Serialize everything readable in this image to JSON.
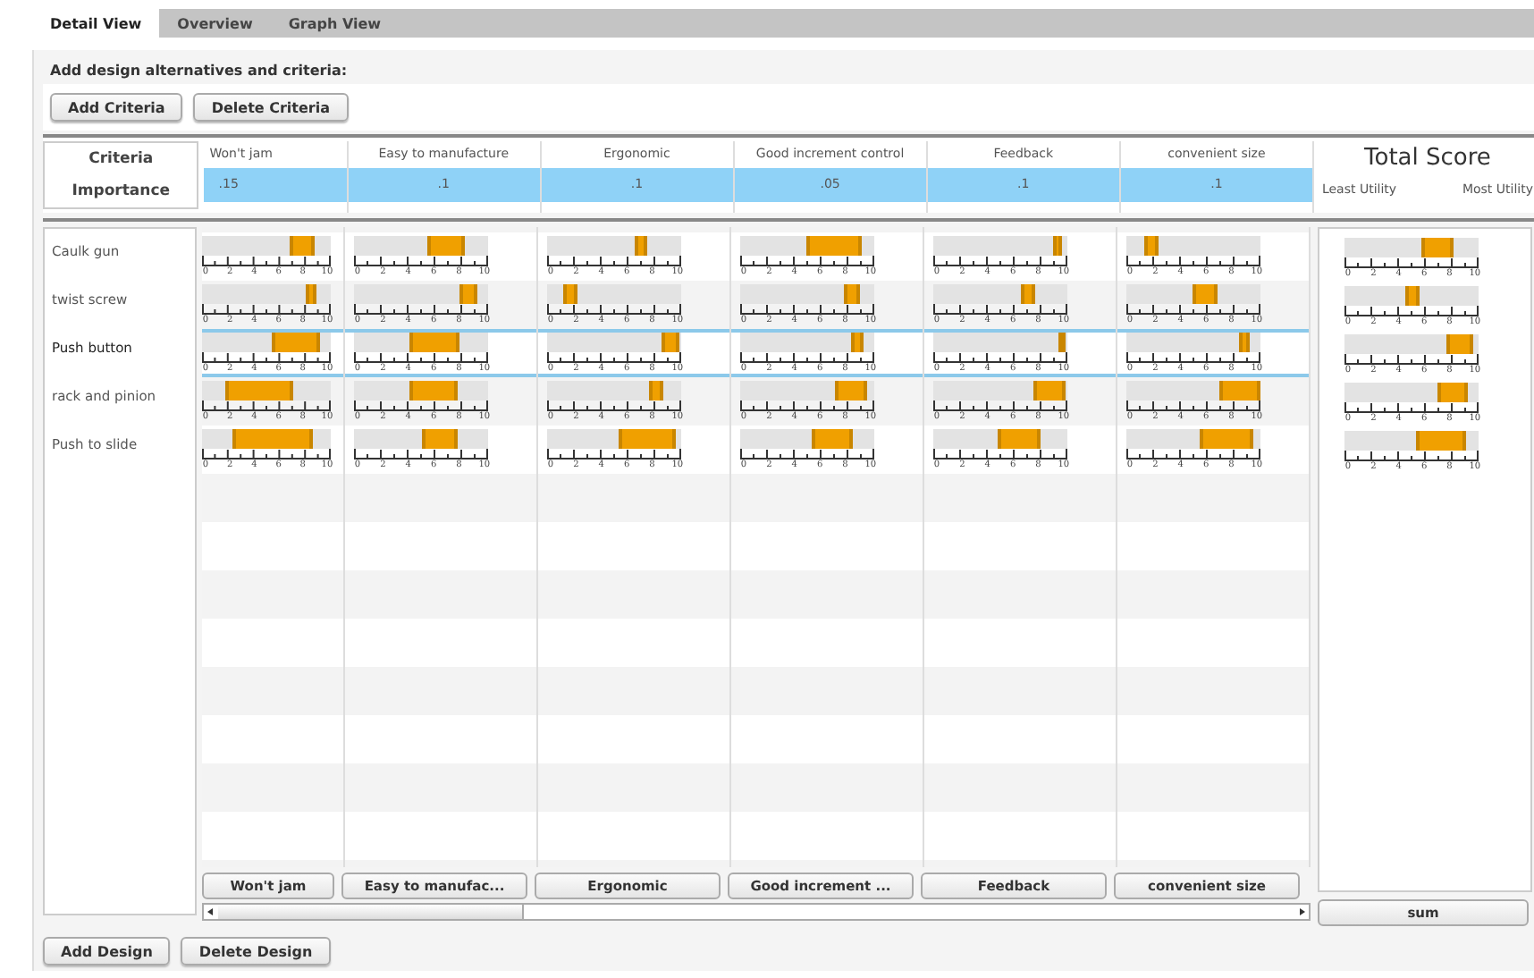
{
  "tabs": [
    {
      "label": "Detail View",
      "selected": true
    },
    {
      "label": "Overview",
      "selected": false
    },
    {
      "label": "Graph View",
      "selected": false
    }
  ],
  "instructions": "Add design alternatives and criteria:",
  "criteria_buttons": [
    "Add Criteria",
    "Delete Criteria"
  ],
  "criteria_header": {
    "criteria_label": "Criteria",
    "importance_label": "Importance"
  },
  "criteria": [
    {
      "name": "Won't jam",
      "importance": ".15"
    },
    {
      "name": "Easy to manufacture",
      "importance": ".1"
    },
    {
      "name": "Ergonomic",
      "importance": ".1"
    },
    {
      "name": "Good increment control",
      "importance": ".05"
    },
    {
      "name": "Feedback",
      "importance": ".1"
    },
    {
      "name": "convenient size",
      "importance": ".1"
    }
  ],
  "total_score": {
    "title": "Total Score",
    "least_label": "Least Utility",
    "most_label": "Most Utility",
    "button": "sum"
  },
  "designs": [
    {
      "name": "Caulk gun",
      "selected": false,
      "ratings": [
        {
          "low": {
            "level": 0.7
          },
          "high": {
            "level": 0.86
          },
          "scale": [
            "0",
            "2",
            "4",
            "6",
            "8",
            "10"
          ]
        },
        {
          "low": {
            "level": 0.56
          },
          "high": {
            "level": 0.81
          },
          "scale": [
            "0",
            "2",
            "4",
            "6",
            "8",
            "10"
          ]
        },
        {
          "low": {
            "level": 0.66
          },
          "high": {
            "level": 0.73
          },
          "scale": [
            "0",
            "2",
            "4",
            "6",
            "8",
            "10"
          ]
        },
        {
          "low": {
            "level": 0.5
          },
          "high": {
            "level": 0.89
          },
          "scale": [
            "0",
            "2",
            "4",
            "6",
            "8",
            "10"
          ]
        },
        {
          "low": {
            "level": 0.91
          },
          "high": {
            "level": 0.95
          },
          "scale": [
            "0",
            "2",
            "4",
            "6",
            "8",
            "10"
          ]
        },
        {
          "low": {
            "level": 0.15
          },
          "high": {
            "level": 0.22
          },
          "scale": [
            "0",
            "2",
            "4",
            "6",
            "8",
            "10"
          ]
        }
      ],
      "total": {
        "low": {
          "level": 0.59
        },
        "high": {
          "level": 0.8
        },
        "scale": [
          "0",
          "2",
          "4",
          "6",
          "8",
          "10"
        ]
      }
    },
    {
      "name": "twist screw",
      "selected": false,
      "ratings": [
        {
          "low": {
            "level": 0.82
          },
          "high": {
            "level": 0.88
          },
          "scale": [
            "0",
            "2",
            "4",
            "6",
            "8",
            "10"
          ]
        },
        {
          "low": {
            "level": 0.8
          },
          "high": {
            "level": 0.9
          },
          "scale": [
            "0",
            "2",
            "4",
            "6",
            "8",
            "10"
          ]
        },
        {
          "low": {
            "level": 0.13
          },
          "high": {
            "level": 0.21
          },
          "scale": [
            "0",
            "2",
            "4",
            "6",
            "8",
            "10"
          ]
        },
        {
          "low": {
            "level": 0.79
          },
          "high": {
            "level": 0.88
          },
          "scale": [
            "0",
            "2",
            "4",
            "6",
            "8",
            "10"
          ]
        },
        {
          "low": {
            "level": 0.67
          },
          "high": {
            "level": 0.75
          },
          "scale": [
            "0",
            "2",
            "4",
            "6",
            "8",
            "10"
          ]
        },
        {
          "low": {
            "level": 0.5
          },
          "high": {
            "level": 0.67
          },
          "scale": [
            "0",
            "2",
            "4",
            "6",
            "8",
            "10"
          ]
        }
      ],
      "total": {
        "low": {
          "level": 0.46
        },
        "high": {
          "level": 0.54
        },
        "scale": [
          "0",
          "2",
          "4",
          "6",
          "8",
          "10"
        ]
      }
    },
    {
      "name": "Push button",
      "selected": true,
      "ratings": [
        {
          "low": {
            "level": 0.55
          },
          "high": {
            "level": 0.9
          },
          "scale": [
            "0",
            "2",
            "4",
            "6",
            "8",
            "10"
          ]
        },
        {
          "low": {
            "level": 0.43
          },
          "high": {
            "level": 0.77
          },
          "scale": [
            "0",
            "2",
            "4",
            "6",
            "8",
            "10"
          ]
        },
        {
          "low": {
            "level": 0.86
          },
          "high": {
            "level": 0.97
          },
          "scale": [
            "0",
            "2",
            "4",
            "6",
            "8",
            "10"
          ]
        },
        {
          "low": {
            "level": 0.84
          },
          "high": {
            "level": 0.91
          },
          "scale": [
            "0",
            "2",
            "4",
            "6",
            "8",
            "10"
          ]
        },
        {
          "low": {
            "level": 0.95
          },
          "high": {
            "level": 0.97
          },
          "scale": [
            "0",
            "2",
            "4",
            "6",
            "8",
            "10"
          ]
        },
        {
          "low": {
            "level": 0.85
          },
          "high": {
            "level": 0.9
          },
          "scale": [
            "0",
            "2",
            "4",
            "6",
            "8",
            "10"
          ]
        }
      ],
      "total": {
        "low": {
          "level": 0.78
        },
        "high": {
          "level": 0.95
        },
        "scale": [
          "0",
          "2",
          "4",
          "6",
          "8",
          "10"
        ]
      }
    },
    {
      "name": "rack and pinion",
      "selected": false,
      "ratings": [
        {
          "low": {
            "level": 0.2
          },
          "high": {
            "level": 0.7
          },
          "scale": [
            "0",
            "2",
            "4",
            "6",
            "8",
            "10"
          ]
        },
        {
          "low": {
            "level": 0.43
          },
          "high": {
            "level": 0.76
          },
          "scale": [
            "0",
            "2",
            "4",
            "6",
            "8",
            "10"
          ]
        },
        {
          "low": {
            "level": 0.78
          },
          "high": {
            "level": 0.85
          },
          "scale": [
            "0",
            "2",
            "4",
            "6",
            "8",
            "10"
          ]
        },
        {
          "low": {
            "level": 0.72
          },
          "high": {
            "level": 0.93
          },
          "scale": [
            "0",
            "2",
            "4",
            "6",
            "8",
            "10"
          ]
        },
        {
          "low": {
            "level": 0.76
          },
          "high": {
            "level": 0.97
          },
          "scale": [
            "0",
            "2",
            "4",
            "6",
            "8",
            "10"
          ]
        },
        {
          "low": {
            "level": 0.7
          },
          "high": {
            "level": 0.98
          },
          "scale": [
            "0",
            "2",
            "4",
            "6",
            "8",
            "10"
          ]
        }
      ],
      "total": {
        "low": {
          "level": 0.7
        },
        "high": {
          "level": 0.91
        },
        "scale": [
          "0",
          "2",
          "4",
          "6",
          "8",
          "10"
        ]
      }
    },
    {
      "name": "Push to slide",
      "selected": false,
      "ratings": [
        {
          "low": {
            "level": 0.25
          },
          "high": {
            "level": 0.85
          },
          "scale": [
            "0",
            "2",
            "4",
            "6",
            "8",
            "10"
          ]
        },
        {
          "low": {
            "level": 0.52
          },
          "high": {
            "level": 0.76
          },
          "scale": [
            "0",
            "2",
            "4",
            "6",
            "8",
            "10"
          ]
        },
        {
          "low": {
            "level": 0.54
          },
          "high": {
            "level": 0.94
          },
          "scale": [
            "0",
            "2",
            "4",
            "6",
            "8",
            "10"
          ]
        },
        {
          "low": {
            "level": 0.54
          },
          "high": {
            "level": 0.82
          },
          "scale": [
            "0",
            "2",
            "4",
            "6",
            "8",
            "10"
          ]
        },
        {
          "low": {
            "level": 0.49
          },
          "high": {
            "level": 0.79
          },
          "scale": [
            "0",
            "2",
            "4",
            "6",
            "8",
            "10"
          ]
        },
        {
          "low": {
            "level": 0.56
          },
          "high": {
            "level": 0.93
          },
          "scale": [
            "0",
            "2",
            "4",
            "6",
            "8",
            "10"
          ]
        }
      ],
      "total": {
        "low": {
          "level": 0.54
        },
        "high": {
          "level": 0.89
        },
        "scale": [
          "0",
          "2",
          "4",
          "6",
          "8",
          "10"
        ]
      }
    }
  ],
  "column_buttons": [
    "Won't jam",
    "Easy to manufac...",
    "Ergonomic",
    "Good increment ...",
    "Feedback",
    "convenient size"
  ],
  "design_buttons": [
    "Add Design",
    "Delete Design"
  ]
}
